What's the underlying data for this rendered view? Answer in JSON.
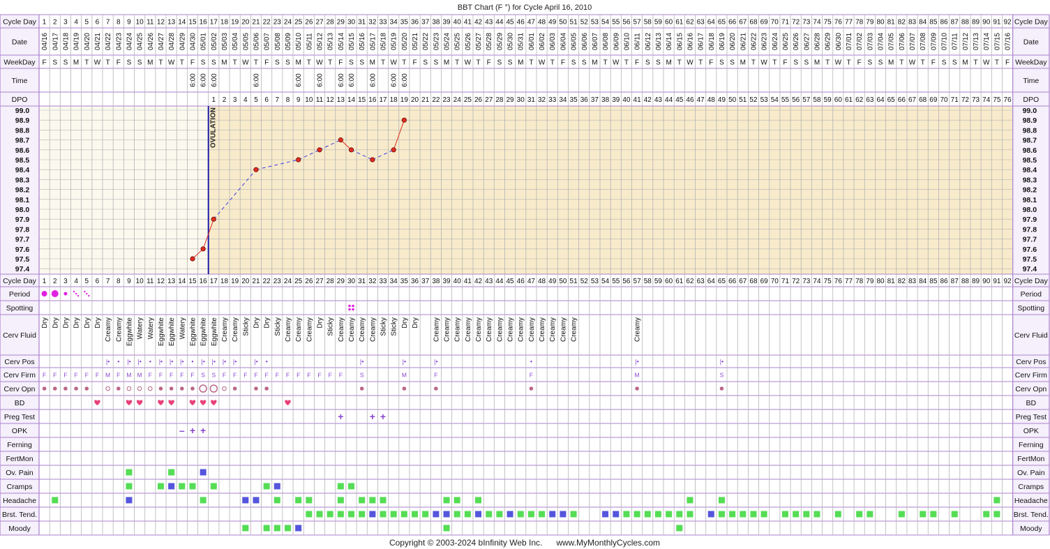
{
  "title": "BBT Chart (F °) for Cycle April 16, 2010",
  "copyright": "Copyright © 2003-2024 bInfinity Web Inc.      www.MyMonthlyCycles.com",
  "ovulation_label": "OVULATION",
  "colors": {
    "border": "#aa80cc",
    "grid": "#b3b3b3",
    "pre_bg": "#fbf9ee",
    "post_bg": "#f8ebcb",
    "label_bg": "#f5f0fb",
    "cover_line": "#1c1ca8",
    "temp_solid": "#e02c20",
    "temp_dashed": "#3d3de8",
    "period": "#e020e0",
    "heart": "#e8407a",
    "green": "#55dd55",
    "blue": "#5555dd",
    "purple": "#8844cc",
    "cervix_dot": "#bb6688"
  },
  "row_labels": {
    "cycle_day": "Cycle Day",
    "date": "Date",
    "weekday": "WeekDay",
    "time": "Time",
    "dpo": "DPO",
    "period": "Period",
    "spotting": "Spotting",
    "cerv_fluid": "Cerv Fluid",
    "cerv_pos": "Cerv Pos",
    "cerv_firm": "Cerv Firm",
    "cerv_opn": "Cerv Opn",
    "bd": "BD",
    "preg_test": "Preg Test",
    "opk": "OPK",
    "ferning": "Ferning",
    "fertmon": "FertMon",
    "ov_pain": "Ov. Pain",
    "cramps": "Cramps",
    "headache": "Headache",
    "brst_tend": "Brst. Tend.",
    "moody": "Moody"
  },
  "chart_data": {
    "type": "line",
    "title": "BBT Chart (F °) for Cycle April 16, 2010",
    "ylim": [
      97.4,
      99.0
    ],
    "y_ticks": [
      "99.0",
      "98.9",
      "98.8",
      "98.7",
      "98.6",
      "98.5",
      "98.4",
      "98.3",
      "98.2",
      "98.1",
      "98.0",
      "97.9",
      "97.8",
      "97.7",
      "97.6",
      "97.5",
      "97.4"
    ],
    "cycle_days": 92,
    "start_date": "04/16",
    "first_weekday": "F",
    "ovulation_day": 16,
    "dpo_start_day": 17,
    "dpo_count": 76,
    "temperatures": [
      {
        "day": 15,
        "temp": 97.5
      },
      {
        "day": 16,
        "temp": 97.6
      },
      {
        "day": 17,
        "temp": 97.9
      },
      {
        "day": 21,
        "temp": 98.4
      },
      {
        "day": 25,
        "temp": 98.5
      },
      {
        "day": 27,
        "temp": 98.6
      },
      {
        "day": 29,
        "temp": 98.7
      },
      {
        "day": 30,
        "temp": 98.6
      },
      {
        "day": 32,
        "temp": 98.5
      },
      {
        "day": 34,
        "temp": 98.6
      },
      {
        "day": 35,
        "temp": 98.9
      }
    ],
    "times": [
      {
        "day": 15,
        "value": "6:00"
      },
      {
        "day": 16,
        "value": "6:00"
      },
      {
        "day": 17,
        "value": "6:00"
      },
      {
        "day": 21,
        "value": "6:00"
      },
      {
        "day": 25,
        "value": "6:00"
      },
      {
        "day": 27,
        "value": "6:00"
      },
      {
        "day": 29,
        "value": "6:00"
      },
      {
        "day": 30,
        "value": "6:00"
      },
      {
        "day": 32,
        "value": "6:00"
      },
      {
        "day": 34,
        "value": "6:00"
      },
      {
        "day": 35,
        "value": "6:00"
      }
    ],
    "period": [
      {
        "day": 1,
        "level": "medium"
      },
      {
        "day": 2,
        "level": "heavy"
      },
      {
        "day": 3,
        "level": "light"
      },
      {
        "day": 4,
        "level": "very-light"
      },
      {
        "day": 5,
        "level": "very-light"
      }
    ],
    "spotting": [
      30
    ],
    "cerv_fluid": [
      {
        "day": 1,
        "value": "Dry"
      },
      {
        "day": 2,
        "value": "Dry"
      },
      {
        "day": 3,
        "value": "Dry"
      },
      {
        "day": 4,
        "value": "Dry"
      },
      {
        "day": 5,
        "value": "Dry"
      },
      {
        "day": 6,
        "value": "Dry"
      },
      {
        "day": 7,
        "value": "Creamy"
      },
      {
        "day": 8,
        "value": "Creamy"
      },
      {
        "day": 9,
        "value": "Eggwhite"
      },
      {
        "day": 10,
        "value": "Watery"
      },
      {
        "day": 11,
        "value": "Watery"
      },
      {
        "day": 12,
        "value": "Eggwhite"
      },
      {
        "day": 13,
        "value": "Eggwhite"
      },
      {
        "day": 14,
        "value": "Watery"
      },
      {
        "day": 15,
        "value": "Eggwhite"
      },
      {
        "day": 16,
        "value": "Eggwhite"
      },
      {
        "day": 17,
        "value": "Eggwhite"
      },
      {
        "day": 18,
        "value": "Creamy"
      },
      {
        "day": 19,
        "value": "Creamy"
      },
      {
        "day": 20,
        "value": "Sticky"
      },
      {
        "day": 21,
        "value": "Dry"
      },
      {
        "day": 22,
        "value": "Dry"
      },
      {
        "day": 23,
        "value": "Sticky"
      },
      {
        "day": 24,
        "value": "Creamy"
      },
      {
        "day": 25,
        "value": "Creamy"
      },
      {
        "day": 26,
        "value": "Creamy"
      },
      {
        "day": 27,
        "value": "Dry"
      },
      {
        "day": 28,
        "value": "Sticky"
      },
      {
        "day": 29,
        "value": "Creamy"
      },
      {
        "day": 30,
        "value": "Creamy"
      },
      {
        "day": 31,
        "value": "Creamy"
      },
      {
        "day": 32,
        "value": "Creamy"
      },
      {
        "day": 33,
        "value": "Sticky"
      },
      {
        "day": 34,
        "value": "Sticky"
      },
      {
        "day": 35,
        "value": "Dry"
      },
      {
        "day": 36,
        "value": "Dry"
      },
      {
        "day": 38,
        "value": "Creamy"
      },
      {
        "day": 39,
        "value": "Creamy"
      },
      {
        "day": 40,
        "value": "Creamy"
      },
      {
        "day": 41,
        "value": "Creamy"
      },
      {
        "day": 42,
        "value": "Creamy"
      },
      {
        "day": 43,
        "value": "Creamy"
      },
      {
        "day": 44,
        "value": "Creamy"
      },
      {
        "day": 45,
        "value": "Creamy"
      },
      {
        "day": 46,
        "value": "Creamy"
      },
      {
        "day": 47,
        "value": "Creamy"
      },
      {
        "day": 48,
        "value": "Creamy"
      },
      {
        "day": 49,
        "value": "Creamy"
      },
      {
        "day": 50,
        "value": "Creamy"
      },
      {
        "day": 51,
        "value": "Creamy"
      },
      {
        "day": 57,
        "value": "Creamy"
      }
    ],
    "cerv_pos": [
      {
        "day": 7,
        "value": "|•"
      },
      {
        "day": 8,
        "value": "•"
      },
      {
        "day": 9,
        "value": "|•"
      },
      {
        "day": 10,
        "value": "|•"
      },
      {
        "day": 11,
        "value": "•"
      },
      {
        "day": 12,
        "value": "|•"
      },
      {
        "day": 13,
        "value": "|•"
      },
      {
        "day": 14,
        "value": "|•"
      },
      {
        "day": 15,
        "value": "•"
      },
      {
        "day": 16,
        "value": "|•"
      },
      {
        "day": 17,
        "value": "|•"
      },
      {
        "day": 18,
        "value": "|•"
      },
      {
        "day": 19,
        "value": "|•"
      },
      {
        "day": 21,
        "value": "|•"
      },
      {
        "day": 22,
        "value": "•"
      },
      {
        "day": 31,
        "value": "|•"
      },
      {
        "day": 35,
        "value": "|•"
      },
      {
        "day": 38,
        "value": "|•"
      },
      {
        "day": 47,
        "value": "•"
      },
      {
        "day": 57,
        "value": "|•"
      },
      {
        "day": 65,
        "value": "|•"
      }
    ],
    "cerv_firm": [
      {
        "day": 1,
        "value": "F"
      },
      {
        "day": 2,
        "value": "F"
      },
      {
        "day": 3,
        "value": "F"
      },
      {
        "day": 4,
        "value": "F"
      },
      {
        "day": 5,
        "value": "F"
      },
      {
        "day": 6,
        "value": "F"
      },
      {
        "day": 7,
        "value": "M"
      },
      {
        "day": 8,
        "value": "F"
      },
      {
        "day": 9,
        "value": "M"
      },
      {
        "day": 10,
        "value": "M"
      },
      {
        "day": 11,
        "value": "F"
      },
      {
        "day": 12,
        "value": "F"
      },
      {
        "day": 13,
        "value": "F"
      },
      {
        "day": 14,
        "value": "F"
      },
      {
        "day": 15,
        "value": "F"
      },
      {
        "day": 16,
        "value": "S"
      },
      {
        "day": 17,
        "value": "S"
      },
      {
        "day": 18,
        "value": "F"
      },
      {
        "day": 19,
        "value": "F"
      },
      {
        "day": 20,
        "value": "F"
      },
      {
        "day": 21,
        "value": "F"
      },
      {
        "day": 22,
        "value": "F"
      },
      {
        "day": 23,
        "value": "F"
      },
      {
        "day": 24,
        "value": "F"
      },
      {
        "day": 25,
        "value": "F"
      },
      {
        "day": 26,
        "value": "F"
      },
      {
        "day": 27,
        "value": "F"
      },
      {
        "day": 28,
        "value": "F"
      },
      {
        "day": 29,
        "value": "F"
      },
      {
        "day": 31,
        "value": "S"
      },
      {
        "day": 35,
        "value": "M"
      },
      {
        "day": 38,
        "value": "F"
      },
      {
        "day": 47,
        "value": "F"
      },
      {
        "day": 57,
        "value": "M"
      },
      {
        "day": 65,
        "value": "S"
      }
    ],
    "cerv_opn": [
      {
        "day": 1,
        "value": "closed"
      },
      {
        "day": 2,
        "value": "closed"
      },
      {
        "day": 3,
        "value": "closed"
      },
      {
        "day": 4,
        "value": "closed"
      },
      {
        "day": 5,
        "value": "closed"
      },
      {
        "day": 7,
        "value": "medium"
      },
      {
        "day": 8,
        "value": "closed"
      },
      {
        "day": 9,
        "value": "medium"
      },
      {
        "day": 10,
        "value": "medium"
      },
      {
        "day": 11,
        "value": "medium"
      },
      {
        "day": 12,
        "value": "closed"
      },
      {
        "day": 13,
        "value": "closed"
      },
      {
        "day": 14,
        "value": "closed"
      },
      {
        "day": 15,
        "value": "closed"
      },
      {
        "day": 16,
        "value": "open"
      },
      {
        "day": 17,
        "value": "open"
      },
      {
        "day": 18,
        "value": "medium"
      },
      {
        "day": 19,
        "value": "closed"
      },
      {
        "day": 21,
        "value": "closed"
      },
      {
        "day": 22,
        "value": "closed"
      },
      {
        "day": 31,
        "value": "closed"
      },
      {
        "day": 35,
        "value": "closed"
      },
      {
        "day": 38,
        "value": "closed"
      },
      {
        "day": 47,
        "value": "closed"
      },
      {
        "day": 57,
        "value": "closed"
      },
      {
        "day": 65,
        "value": "closed"
      }
    ],
    "bd": [
      6,
      9,
      10,
      12,
      13,
      15,
      16,
      17,
      24
    ],
    "preg_test": [
      29,
      32,
      33
    ],
    "opk": [
      {
        "day": 14,
        "value": "negative"
      },
      {
        "day": 15,
        "value": "positive"
      },
      {
        "day": 16,
        "value": "positive"
      }
    ],
    "ferning": [],
    "fertmon": [],
    "ov_pain": [
      {
        "day": 9,
        "c": "green"
      },
      {
        "day": 13,
        "c": "green"
      },
      {
        "day": 16,
        "c": "blue"
      }
    ],
    "cramps": [
      {
        "day": 9,
        "c": "green"
      },
      {
        "day": 12,
        "c": "green"
      },
      {
        "day": 13,
        "c": "blue"
      },
      {
        "day": 14,
        "c": "green"
      },
      {
        "day": 15,
        "c": "green"
      },
      {
        "day": 17,
        "c": "green"
      },
      {
        "day": 22,
        "c": "green"
      },
      {
        "day": 23,
        "c": "blue"
      },
      {
        "day": 29,
        "c": "green"
      },
      {
        "day": 30,
        "c": "green"
      }
    ],
    "headache": [
      {
        "day": 2,
        "c": "green"
      },
      {
        "day": 9,
        "c": "blue"
      },
      {
        "day": 16,
        "c": "green"
      },
      {
        "day": 20,
        "c": "blue"
      },
      {
        "day": 21,
        "c": "blue"
      },
      {
        "day": 23,
        "c": "green"
      },
      {
        "day": 25,
        "c": "green"
      },
      {
        "day": 26,
        "c": "green"
      },
      {
        "day": 29,
        "c": "green"
      },
      {
        "day": 31,
        "c": "green"
      },
      {
        "day": 32,
        "c": "green"
      },
      {
        "day": 33,
        "c": "green"
      },
      {
        "day": 39,
        "c": "green"
      },
      {
        "day": 40,
        "c": "green"
      },
      {
        "day": 42,
        "c": "green"
      },
      {
        "day": 62,
        "c": "green"
      },
      {
        "day": 65,
        "c": "green"
      },
      {
        "day": 91,
        "c": "green"
      }
    ],
    "brst_tend": [
      {
        "day": 26,
        "c": "green"
      },
      {
        "day": 27,
        "c": "green"
      },
      {
        "day": 28,
        "c": "green"
      },
      {
        "day": 29,
        "c": "green"
      },
      {
        "day": 30,
        "c": "green"
      },
      {
        "day": 31,
        "c": "green"
      },
      {
        "day": 32,
        "c": "blue"
      },
      {
        "day": 33,
        "c": "green"
      },
      {
        "day": 34,
        "c": "green"
      },
      {
        "day": 35,
        "c": "green"
      },
      {
        "day": 36,
        "c": "green"
      },
      {
        "day": 37,
        "c": "green"
      },
      {
        "day": 38,
        "c": "blue"
      },
      {
        "day": 39,
        "c": "blue"
      },
      {
        "day": 40,
        "c": "green"
      },
      {
        "day": 41,
        "c": "green"
      },
      {
        "day": 42,
        "c": "blue"
      },
      {
        "day": 43,
        "c": "green"
      },
      {
        "day": 44,
        "c": "green"
      },
      {
        "day": 45,
        "c": "blue"
      },
      {
        "day": 46,
        "c": "green"
      },
      {
        "day": 47,
        "c": "green"
      },
      {
        "day": 48,
        "c": "green"
      },
      {
        "day": 49,
        "c": "blue"
      },
      {
        "day": 50,
        "c": "blue"
      },
      {
        "day": 51,
        "c": "green"
      },
      {
        "day": 54,
        "c": "blue"
      },
      {
        "day": 55,
        "c": "blue"
      },
      {
        "day": 56,
        "c": "green"
      },
      {
        "day": 57,
        "c": "green"
      },
      {
        "day": 58,
        "c": "green"
      },
      {
        "day": 59,
        "c": "green"
      },
      {
        "day": 60,
        "c": "green"
      },
      {
        "day": 61,
        "c": "green"
      },
      {
        "day": 62,
        "c": "green"
      },
      {
        "day": 64,
        "c": "blue"
      },
      {
        "day": 65,
        "c": "green"
      },
      {
        "day": 66,
        "c": "green"
      },
      {
        "day": 67,
        "c": "green"
      },
      {
        "day": 68,
        "c": "green"
      },
      {
        "day": 69,
        "c": "green"
      },
      {
        "day": 71,
        "c": "green"
      },
      {
        "day": 72,
        "c": "green"
      },
      {
        "day": 73,
        "c": "green"
      },
      {
        "day": 74,
        "c": "green"
      },
      {
        "day": 76,
        "c": "green"
      },
      {
        "day": 78,
        "c": "green"
      },
      {
        "day": 79,
        "c": "green"
      },
      {
        "day": 82,
        "c": "green"
      },
      {
        "day": 84,
        "c": "green"
      },
      {
        "day": 85,
        "c": "green"
      },
      {
        "day": 87,
        "c": "green"
      },
      {
        "day": 90,
        "c": "green"
      },
      {
        "day": 91,
        "c": "green"
      }
    ],
    "moody": [
      {
        "day": 20,
        "c": "green"
      },
      {
        "day": 22,
        "c": "green"
      },
      {
        "day": 23,
        "c": "green"
      },
      {
        "day": 24,
        "c": "green"
      },
      {
        "day": 25,
        "c": "blue"
      },
      {
        "day": 39,
        "c": "green"
      },
      {
        "day": 61,
        "c": "green"
      }
    ]
  }
}
